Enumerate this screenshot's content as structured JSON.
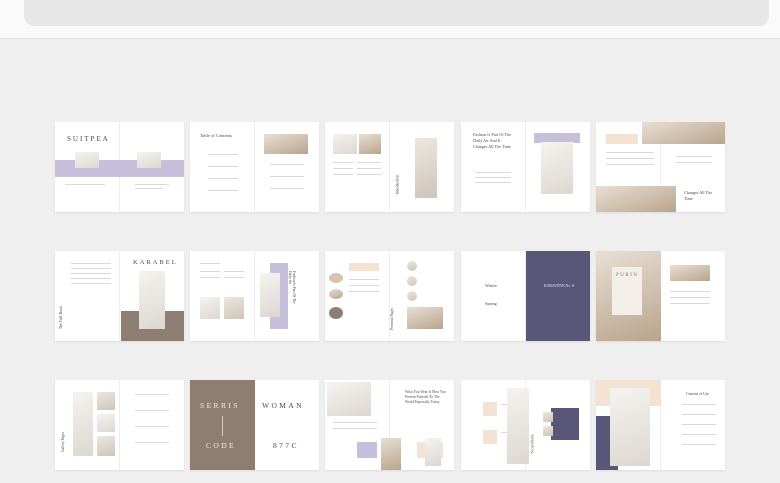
{
  "spreads": [
    {
      "titles": [
        "SUITPEA"
      ]
    },
    {
      "titles": [
        "Table of Contents"
      ]
    },
    {
      "titles": [
        "Introduction"
      ]
    },
    {
      "titles": [
        "Fashion Is Part Of The Daily Air And It Changes All The Time"
      ]
    },
    {
      "titles": [
        "Changes All The Time"
      ]
    },
    {
      "titles": [
        "KARABEL",
        "The Full Book"
      ]
    },
    {
      "titles": [
        "Fashion Is Part Of The Daily Air"
      ]
    },
    {
      "titles": [
        "Personal Pages"
      ]
    },
    {
      "titles": [
        "KORAVENN No. 8",
        "Winter",
        "Spring"
      ]
    },
    {
      "titles": [
        "PURIN"
      ]
    },
    {
      "titles": [
        "Gallery Pages"
      ]
    },
    {
      "titles": [
        "SERRIS",
        "CODE",
        "WOMAN",
        "877C"
      ]
    },
    {
      "titles": [
        "What You Wear Is How You Present Yourself To The World Especially Today"
      ]
    },
    {
      "titles": [
        "Social Media"
      ]
    },
    {
      "titles": [
        "Content of Use"
      ]
    }
  ]
}
